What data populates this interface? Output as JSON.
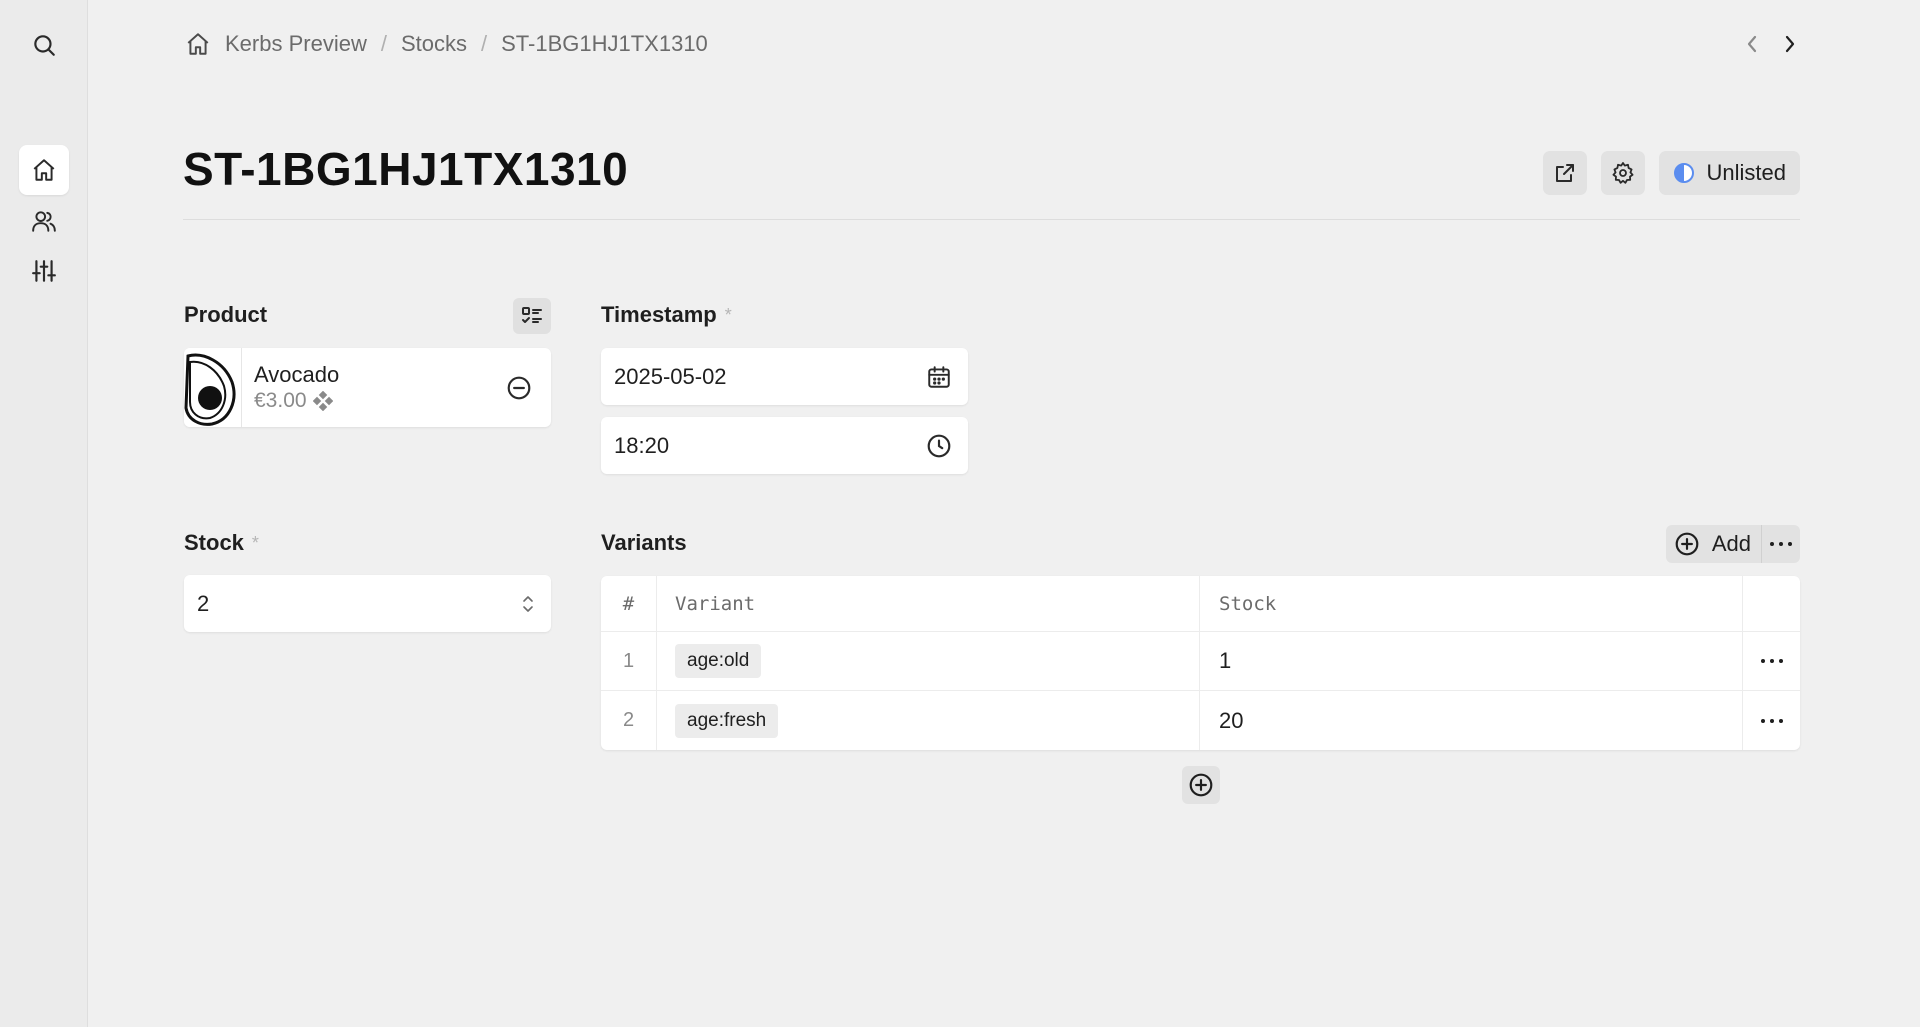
{
  "breadcrumb": {
    "items": [
      "Kerbs Preview",
      "Stocks",
      "ST-1BG1HJ1TX1310"
    ],
    "separator": "/"
  },
  "page": {
    "title": "ST-1BG1HJ1TX1310",
    "status_label": "Unlisted"
  },
  "product": {
    "label": "Product",
    "name": "Avocado",
    "price": "€3.00"
  },
  "timestamp": {
    "label": "Timestamp",
    "required_mark": "*",
    "date": "2025-05-02",
    "time": "18:20"
  },
  "stock": {
    "label": "Stock",
    "required_mark": "*",
    "value": "2"
  },
  "variants": {
    "label": "Variants",
    "add_label": "Add",
    "columns": [
      "#",
      "Variant",
      "Stock"
    ],
    "rows": [
      {
        "num": "1",
        "variant": "age:old",
        "stock": "1"
      },
      {
        "num": "2",
        "variant": "age:fresh",
        "stock": "20"
      }
    ]
  },
  "colors": {
    "background": "#f0f0f0",
    "sidebar": "#ebebeb",
    "card": "#ffffff",
    "status_accent": "#5b8def"
  },
  "icons": {
    "sidebar": [
      "search-icon",
      "home-icon",
      "users-icon",
      "sliders-icon"
    ],
    "title_actions": [
      "external-link-icon",
      "gear-icon",
      "half-circle-icon"
    ]
  }
}
